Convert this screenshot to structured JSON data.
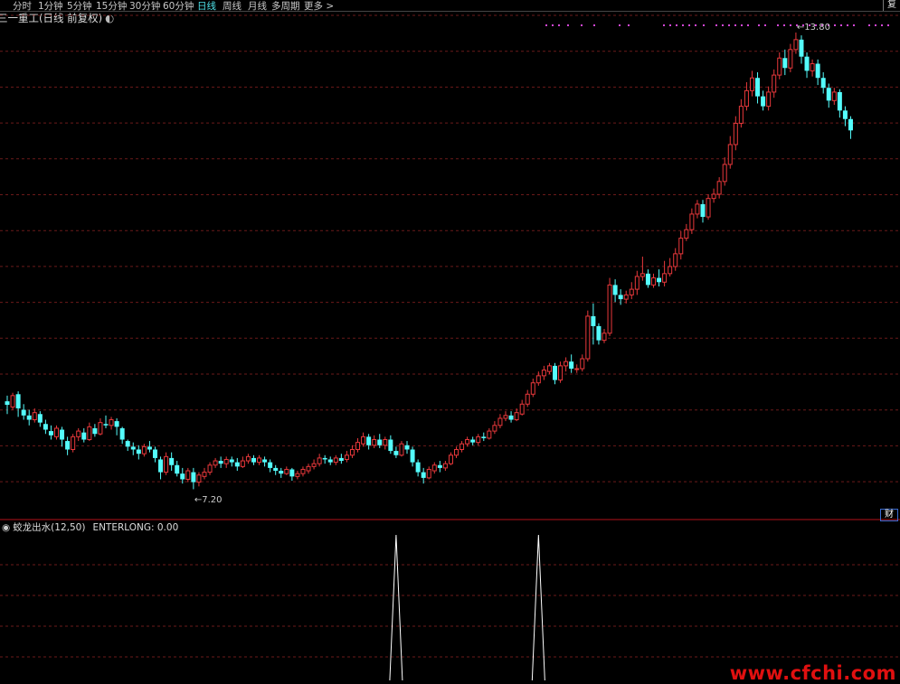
{
  "toolbar": {
    "periods": [
      "分时",
      "1分钟",
      "5分钟",
      "15分钟",
      "30分钟",
      "60分钟",
      "日线",
      "周线",
      "月线",
      "多周期",
      "更多 >"
    ],
    "active_period": "日线",
    "corner_button": "复"
  },
  "stock": {
    "title": "三一重工(日线 前复权)",
    "toggle_icon": "chevron-circle-icon"
  },
  "price_labels": {
    "high": "13.80",
    "low": "7.20"
  },
  "indicator": {
    "title": "蛟龙出水(12,50)",
    "name": "ENTERLONG: 0.00",
    "cai_button": "财"
  },
  "watermark": "www.cfchi.com",
  "colors": {
    "up": "#e8383b",
    "down": "#54fcfc",
    "grid": "#6b1a1a",
    "signal_line": "#ffffff",
    "dots": "#d247d6"
  },
  "chart_data": {
    "type": "candlestick",
    "price_range": [
      7.2,
      13.8
    ],
    "high_label": 13.8,
    "low_label": 7.2,
    "candles": [
      [
        8.6,
        8.55,
        8.68,
        8.42
      ],
      [
        8.52,
        8.68,
        8.72,
        8.48
      ],
      [
        8.7,
        8.5,
        8.74,
        8.38
      ],
      [
        8.48,
        8.4,
        8.56,
        8.34
      ],
      [
        8.4,
        8.34,
        8.48,
        8.26
      ],
      [
        8.34,
        8.44,
        8.5,
        8.3
      ],
      [
        8.42,
        8.3,
        8.46,
        8.24
      ],
      [
        8.28,
        8.2,
        8.34,
        8.14
      ],
      [
        8.18,
        8.12,
        8.26,
        8.06
      ],
      [
        8.1,
        8.22,
        8.26,
        8.06
      ],
      [
        8.2,
        8.06,
        8.24,
        7.96
      ],
      [
        8.04,
        7.92,
        8.1,
        7.84
      ],
      [
        7.92,
        8.1,
        8.14,
        7.88
      ],
      [
        8.1,
        8.18,
        8.22,
        8.04
      ],
      [
        8.16,
        8.06,
        8.22,
        8.02
      ],
      [
        8.06,
        8.24,
        8.3,
        8.04
      ],
      [
        8.22,
        8.14,
        8.28,
        8.1
      ],
      [
        8.14,
        8.3,
        8.36,
        8.12
      ],
      [
        8.28,
        8.26,
        8.4,
        8.22
      ],
      [
        8.26,
        8.34,
        8.38,
        8.2
      ],
      [
        8.32,
        8.24,
        8.36,
        8.12
      ],
      [
        8.22,
        8.06,
        8.24,
        8.0
      ],
      [
        8.04,
        7.96,
        8.06,
        7.9
      ],
      [
        7.96,
        7.92,
        8.02,
        7.84
      ],
      [
        7.92,
        7.86,
        7.98,
        7.78
      ],
      [
        7.86,
        7.96,
        8.0,
        7.82
      ],
      [
        7.96,
        7.92,
        8.04,
        7.88
      ],
      [
        7.92,
        7.8,
        7.96,
        7.74
      ],
      [
        7.78,
        7.6,
        7.82,
        7.5
      ],
      [
        7.6,
        7.82,
        7.88,
        7.56
      ],
      [
        7.8,
        7.7,
        7.88,
        7.62
      ],
      [
        7.7,
        7.58,
        7.76,
        7.54
      ],
      [
        7.58,
        7.5,
        7.66,
        7.44
      ],
      [
        7.5,
        7.62,
        7.66,
        7.46
      ],
      [
        7.6,
        7.46,
        7.66,
        7.36
      ],
      [
        7.46,
        7.56,
        7.6,
        7.4
      ],
      [
        7.54,
        7.6,
        7.66,
        7.5
      ],
      [
        7.6,
        7.7,
        7.74,
        7.56
      ],
      [
        7.7,
        7.76,
        7.8,
        7.66
      ],
      [
        7.76,
        7.72,
        7.82,
        7.66
      ],
      [
        7.72,
        7.78,
        7.82,
        7.66
      ],
      [
        7.78,
        7.74,
        7.82,
        7.68
      ],
      [
        7.74,
        7.68,
        7.8,
        7.62
      ],
      [
        7.68,
        7.76,
        7.82,
        7.66
      ],
      [
        7.76,
        7.82,
        7.86,
        7.72
      ],
      [
        7.8,
        7.74,
        7.84,
        7.7
      ],
      [
        7.74,
        7.8,
        7.84,
        7.7
      ],
      [
        7.78,
        7.74,
        7.82,
        7.68
      ],
      [
        7.74,
        7.66,
        7.78,
        7.6
      ],
      [
        7.66,
        7.62,
        7.7,
        7.56
      ],
      [
        7.62,
        7.58,
        7.66,
        7.52
      ],
      [
        7.58,
        7.64,
        7.68,
        7.56
      ],
      [
        7.64,
        7.54,
        7.66,
        7.48
      ],
      [
        7.54,
        7.58,
        7.62,
        7.5
      ],
      [
        7.58,
        7.64,
        7.68,
        7.54
      ],
      [
        7.62,
        7.68,
        7.72,
        7.58
      ],
      [
        7.68,
        7.72,
        7.78,
        7.64
      ],
      [
        7.72,
        7.8,
        7.86,
        7.68
      ],
      [
        7.8,
        7.78,
        7.84,
        7.72
      ],
      [
        7.78,
        7.74,
        7.82,
        7.7
      ],
      [
        7.74,
        7.8,
        7.84,
        7.7
      ],
      [
        7.8,
        7.76,
        7.86,
        7.72
      ],
      [
        7.78,
        7.84,
        7.9,
        7.74
      ],
      [
        7.84,
        7.92,
        7.98,
        7.8
      ],
      [
        7.92,
        8.02,
        8.08,
        7.88
      ],
      [
        8.0,
        8.1,
        8.16,
        7.96
      ],
      [
        8.1,
        7.98,
        8.14,
        7.92
      ],
      [
        7.98,
        8.06,
        8.12,
        7.94
      ],
      [
        8.06,
        7.98,
        8.14,
        7.94
      ],
      [
        7.98,
        8.06,
        8.1,
        7.92
      ],
      [
        8.06,
        7.9,
        8.12,
        7.86
      ],
      [
        7.9,
        7.84,
        7.96,
        7.8
      ],
      [
        7.84,
        8.0,
        8.04,
        7.82
      ],
      [
        7.98,
        7.92,
        8.04,
        7.86
      ],
      [
        7.92,
        7.74,
        7.96,
        7.68
      ],
      [
        7.74,
        7.6,
        7.78,
        7.54
      ],
      [
        7.6,
        7.52,
        7.66,
        7.44
      ],
      [
        7.52,
        7.64,
        7.68,
        7.5
      ],
      [
        7.62,
        7.7,
        7.74,
        7.58
      ],
      [
        7.7,
        7.66,
        7.76,
        7.6
      ],
      [
        7.66,
        7.72,
        7.76,
        7.62
      ],
      [
        7.72,
        7.84,
        7.88,
        7.7
      ],
      [
        7.84,
        7.92,
        7.96,
        7.8
      ],
      [
        7.92,
        8.0,
        8.04,
        7.88
      ],
      [
        8.0,
        8.06,
        8.1,
        7.96
      ],
      [
        8.06,
        8.02,
        8.1,
        7.98
      ],
      [
        8.02,
        8.1,
        8.14,
        7.98
      ],
      [
        8.1,
        8.08,
        8.16,
        8.04
      ],
      [
        8.08,
        8.18,
        8.22,
        8.06
      ],
      [
        8.18,
        8.26,
        8.32,
        8.14
      ],
      [
        8.26,
        8.36,
        8.42,
        8.22
      ],
      [
        8.36,
        8.4,
        8.46,
        8.32
      ],
      [
        8.4,
        8.34,
        8.46,
        8.3
      ],
      [
        8.34,
        8.44,
        8.5,
        8.32
      ],
      [
        8.42,
        8.56,
        8.62,
        8.4
      ],
      [
        8.56,
        8.7,
        8.76,
        8.52
      ],
      [
        8.7,
        8.86,
        8.92,
        8.66
      ],
      [
        8.86,
        8.96,
        9.02,
        8.82
      ],
      [
        8.96,
        9.04,
        9.1,
        8.9
      ],
      [
        9.02,
        9.1,
        9.14,
        8.98
      ],
      [
        9.1,
        8.9,
        9.14,
        8.84
      ],
      [
        8.9,
        9.1,
        9.16,
        8.86
      ],
      [
        9.1,
        9.16,
        9.22,
        9.02
      ],
      [
        9.16,
        9.06,
        9.26,
        9.0
      ],
      [
        9.06,
        9.06,
        9.12,
        9.0
      ],
      [
        9.06,
        9.2,
        9.26,
        9.02
      ],
      [
        9.2,
        9.8,
        9.88,
        9.16
      ],
      [
        9.8,
        9.66,
        9.98,
        9.4
      ],
      [
        9.66,
        9.46,
        9.7,
        9.4
      ],
      [
        9.46,
        9.56,
        9.62,
        9.42
      ],
      [
        9.56,
        10.24,
        10.34,
        9.52
      ],
      [
        10.24,
        10.1,
        10.32,
        10.0
      ],
      [
        10.1,
        10.04,
        10.18,
        9.96
      ],
      [
        10.04,
        10.1,
        10.16,
        9.98
      ],
      [
        10.1,
        10.18,
        10.28,
        10.04
      ],
      [
        10.18,
        10.36,
        10.44,
        10.1
      ],
      [
        10.36,
        10.4,
        10.64,
        10.3
      ],
      [
        10.4,
        10.24,
        10.46,
        10.2
      ],
      [
        10.24,
        10.34,
        10.4,
        10.2
      ],
      [
        10.34,
        10.28,
        10.46,
        10.22
      ],
      [
        10.28,
        10.4,
        10.58,
        10.22
      ],
      [
        10.4,
        10.5,
        10.62,
        10.36
      ],
      [
        10.5,
        10.68,
        10.76,
        10.44
      ],
      [
        10.68,
        10.9,
        11.0,
        10.6
      ],
      [
        10.9,
        11.02,
        11.1,
        10.86
      ],
      [
        11.02,
        11.24,
        11.32,
        10.96
      ],
      [
        11.24,
        11.38,
        11.44,
        11.18
      ],
      [
        11.38,
        11.2,
        11.44,
        11.12
      ],
      [
        11.2,
        11.46,
        11.52,
        11.16
      ],
      [
        11.46,
        11.52,
        11.6,
        11.4
      ],
      [
        11.52,
        11.7,
        11.76,
        11.46
      ],
      [
        11.7,
        11.94,
        12.04,
        11.64
      ],
      [
        11.94,
        12.22,
        12.34,
        11.88
      ],
      [
        12.22,
        12.52,
        12.62,
        12.14
      ],
      [
        12.52,
        12.76,
        12.86,
        12.46
      ],
      [
        12.76,
        12.98,
        13.1,
        12.7
      ],
      [
        12.98,
        13.16,
        13.26,
        12.9
      ],
      [
        13.16,
        12.9,
        13.24,
        12.8
      ],
      [
        12.9,
        12.76,
        12.98,
        12.7
      ],
      [
        12.76,
        12.96,
        13.04,
        12.7
      ],
      [
        12.96,
        13.2,
        13.28,
        12.88
      ],
      [
        13.2,
        13.44,
        13.52,
        13.14
      ],
      [
        13.44,
        13.3,
        13.56,
        13.2
      ],
      [
        13.3,
        13.56,
        13.64,
        13.24
      ],
      [
        13.56,
        13.7,
        13.8,
        13.5
      ],
      [
        13.7,
        13.46,
        13.76,
        13.36
      ],
      [
        13.46,
        13.26,
        13.52,
        13.16
      ],
      [
        13.26,
        13.36,
        13.42,
        13.18
      ],
      [
        13.36,
        13.16,
        13.42,
        13.06
      ],
      [
        13.16,
        13.02,
        13.24,
        12.94
      ],
      [
        13.02,
        12.84,
        13.08,
        12.74
      ],
      [
        12.84,
        12.96,
        13.02,
        12.78
      ],
      [
        12.96,
        12.7,
        13.0,
        12.6
      ],
      [
        12.7,
        12.58,
        12.76,
        12.48
      ],
      [
        12.58,
        12.42,
        12.62,
        12.3
      ]
    ],
    "signals_at_candle": [
      71,
      97
    ],
    "signal_range": [
      0,
      1
    ]
  }
}
